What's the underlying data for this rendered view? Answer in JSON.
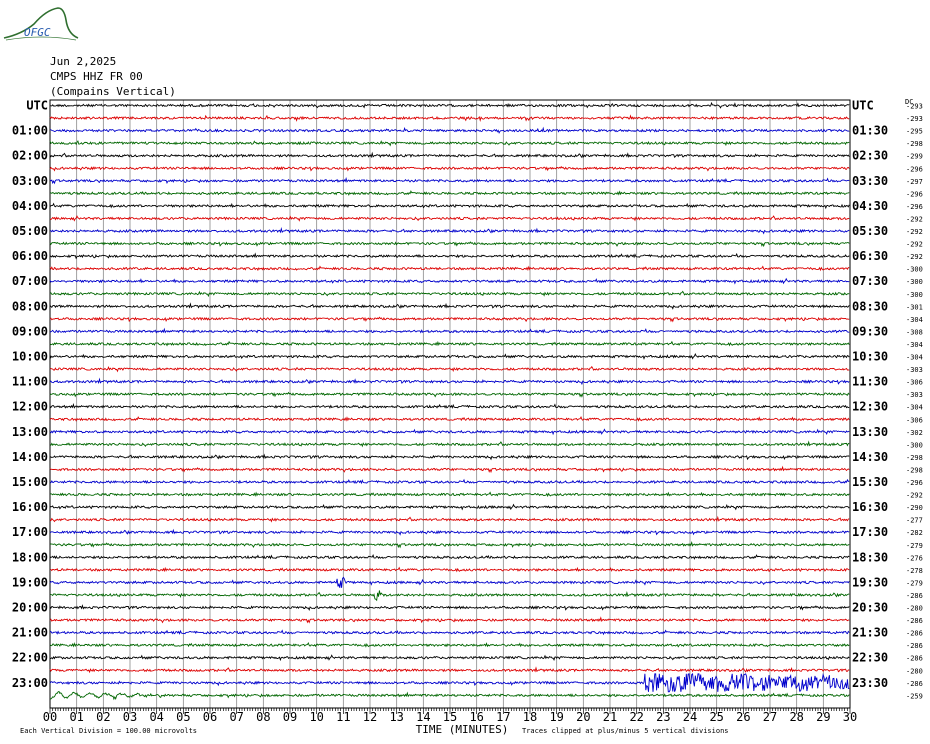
{
  "header": {
    "logo_text": "OFGC",
    "date": "Jun 2,2025",
    "station": "CMPS HHZ FR 00",
    "location": "(Compains Vertical)",
    "utc_left": "UTC",
    "utc_right": "UTC",
    "dc_label": "DC"
  },
  "footer": {
    "xlabel": "TIME (MINUTES)",
    "scale_note": "Each Vertical Division =  100.00 microvolts",
    "clip_note": "Traces clipped at plus/minus 5 vertical divisions"
  },
  "chart_data": {
    "type": "line",
    "title": "Jun 2,2025  CMPS HHZ FR 00  (Compains Vertical)",
    "xlabel": "TIME (MINUTES)",
    "ylabel": "UTC",
    "x_range": [
      0,
      30
    ],
    "x_ticks": [
      "00",
      "01",
      "02",
      "03",
      "04",
      "05",
      "06",
      "07",
      "08",
      "09",
      "10",
      "11",
      "12",
      "13",
      "14",
      "15",
      "16",
      "17",
      "18",
      "19",
      "20",
      "21",
      "22",
      "23",
      "24",
      "25",
      "26",
      "27",
      "28",
      "29",
      "30"
    ],
    "grid": true,
    "line_colors": [
      "#000000",
      "#dd0000",
      "#0000cc",
      "#006600"
    ],
    "left_labels": [
      "UTC",
      "01:00",
      "02:00",
      "03:00",
      "04:00",
      "05:00",
      "06:00",
      "07:00",
      "08:00",
      "09:00",
      "10:00",
      "11:00",
      "12:00",
      "13:00",
      "14:00",
      "15:00",
      "16:00",
      "17:00",
      "18:00",
      "19:00",
      "20:00",
      "21:00",
      "22:00",
      "23:00"
    ],
    "right_labels": [
      "UTC",
      "01:30",
      "02:30",
      "03:30",
      "04:30",
      "05:30",
      "06:30",
      "07:30",
      "08:30",
      "09:30",
      "10:30",
      "11:30",
      "12:30",
      "13:30",
      "14:30",
      "15:30",
      "16:30",
      "17:30",
      "18:30",
      "19:30",
      "20:30",
      "21:30",
      "22:30",
      "23:30"
    ],
    "dc_offsets": [
      "-293",
      "-293",
      "-295",
      "-298",
      "-299",
      "-296",
      "-297",
      "-296",
      "-296",
      "-292",
      "-292",
      "-292",
      "-292",
      "-300",
      "-300",
      "-300",
      "-301",
      "-304",
      "-308",
      "-304",
      "-304",
      "-303",
      "-306",
      "-303",
      "-304",
      "-306",
      "-302",
      "-300",
      "-298",
      "-298",
      "-296",
      "-292",
      "-290",
      "-277",
      "-282",
      "-279",
      "-276",
      "-278",
      "-279",
      "-286",
      "-280",
      "-286",
      "-286",
      "-286",
      "-286",
      "-280",
      "-286",
      "-259"
    ],
    "events": [
      {
        "trace": 38,
        "minute": 10.9,
        "note": "spike"
      },
      {
        "trace": 39,
        "minute": 12.3,
        "note": "spike"
      },
      {
        "trace": 46,
        "minute": 22.3,
        "note": "large signal"
      }
    ],
    "scale": "100.00 microvolts per vertical division",
    "clip": "plus/minus 5 vertical divisions"
  }
}
